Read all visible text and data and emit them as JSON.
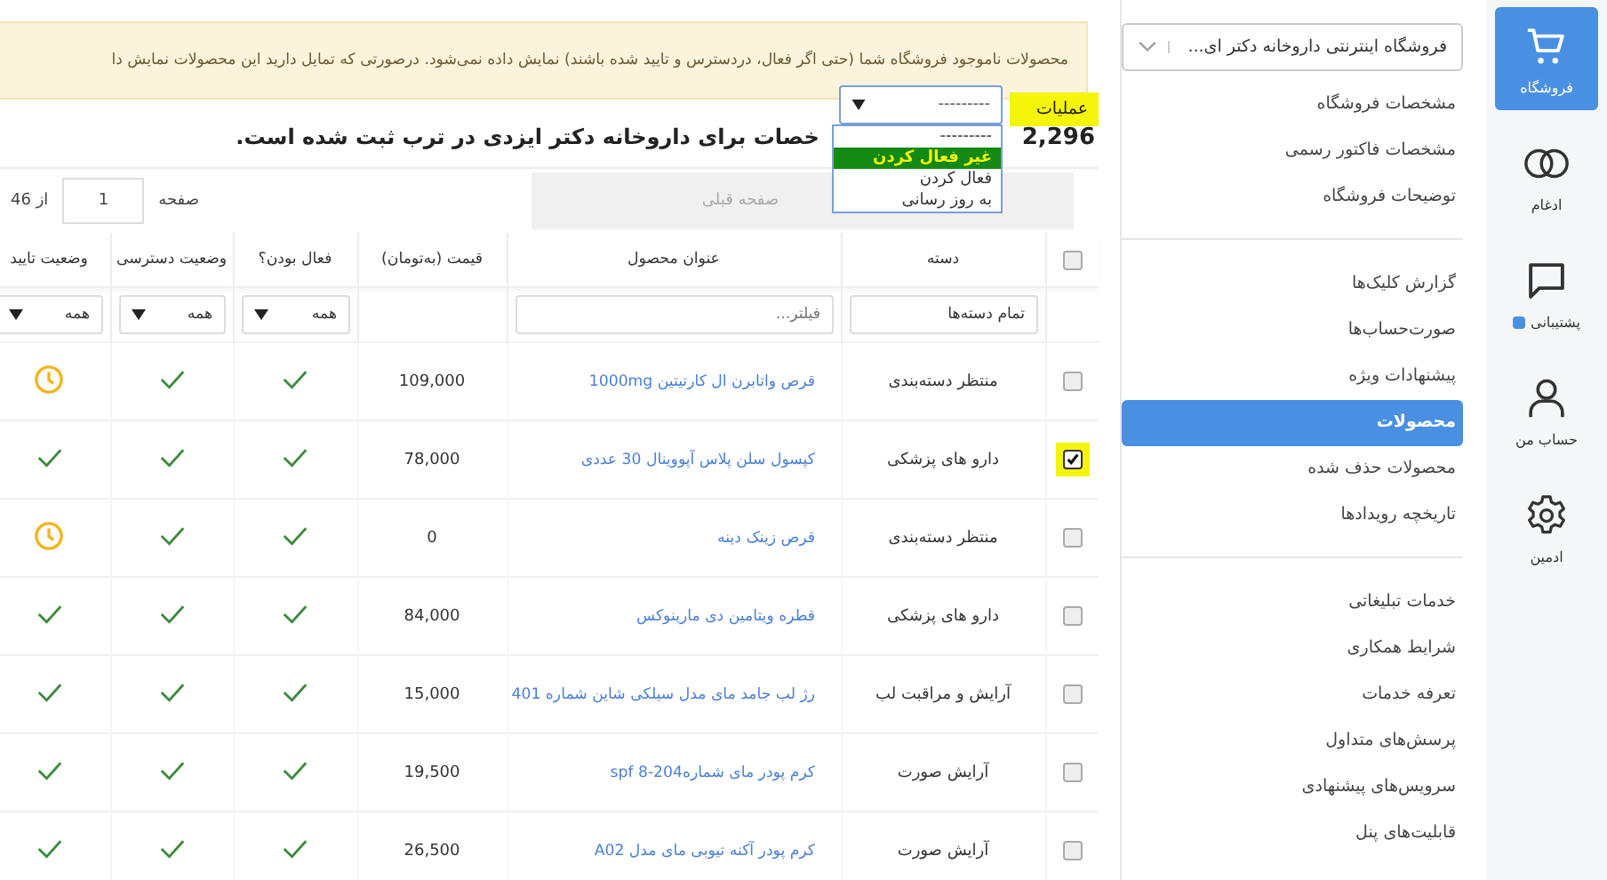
{
  "rail": [
    {
      "label": "فروشگاه",
      "kind": "cart",
      "selected": true
    },
    {
      "label": "ادغام",
      "kind": "rings",
      "selected": false
    },
    {
      "label": "پشتیبانی",
      "kind": "chat",
      "selected": false,
      "badge": true
    },
    {
      "label": "حساب من",
      "kind": "person",
      "selected": false
    },
    {
      "label": "ادمین",
      "kind": "gear",
      "selected": false
    }
  ],
  "sidebar": {
    "store_select": "فروشگاه اینترنتی داروخانه دکتر ای...",
    "groups": [
      [
        {
          "label": "مشخصات فروشگاه",
          "selected": false
        },
        {
          "label": "مشخصات فاکتور رسمی",
          "selected": false
        },
        {
          "label": "توضیحات فروشگاه",
          "selected": false
        }
      ],
      [
        {
          "label": "گزارش کلیک‌ها",
          "selected": false
        },
        {
          "label": "صورت‌حساب‌ها",
          "selected": false
        },
        {
          "label": "پیشنهادات ویژه",
          "selected": false
        },
        {
          "label": "محصولات",
          "selected": true
        },
        {
          "label": "محصولات حذف شده",
          "selected": false
        },
        {
          "label": "تاریخچه رویدادها",
          "selected": false
        }
      ],
      [
        {
          "label": "خدمات تبلیغاتی",
          "selected": false
        },
        {
          "label": "شرایط همکاری",
          "selected": false
        },
        {
          "label": "تعرفه خدمات",
          "selected": false
        },
        {
          "label": "پرسش‌های متداول",
          "selected": false
        },
        {
          "label": "سرویس‌های پیشنهادی",
          "selected": false
        },
        {
          "label": "قابلیت‌های پنل",
          "selected": false
        }
      ]
    ]
  },
  "banner": "محصولات ناموجود فروشگاه شما (حتی اگر فعال، دردسترس و تایید شده باشند) نمایش داده نمی‌شود. درصورتی که تمایل دارید این محصولات نمایش دا",
  "actions": {
    "label": "عملیات",
    "value": "---------",
    "options": [
      {
        "label": "---------",
        "highlighted": false
      },
      {
        "label": "غیر فعال کردن",
        "highlighted": true
      },
      {
        "label": "فعال کردن",
        "highlighted": false
      },
      {
        "label": "به روز رسانی",
        "highlighted": false
      }
    ]
  },
  "title": {
    "count": "2,296",
    "text": "خصات برای داروخانه دکتر ایزدی در ترب ثبت شده است."
  },
  "pagination": {
    "prev": "صفحه قبلی",
    "page_label": "صفحه",
    "page": "1",
    "of": "از 46"
  },
  "table": {
    "columns": [
      "دسته",
      "عنوان محصول",
      "قیمت (به‌تومان)",
      "فعال بودن؟",
      "وضعیت دسترسی",
      "وضعیت تایید"
    ],
    "filters": {
      "category": "تمام دسته‌ها",
      "title_placeholder": "فیلتر...",
      "active": "همه",
      "access": "همه",
      "approval": "همه"
    },
    "select_all_checked": false,
    "rows": [
      {
        "checked": false,
        "category": "منتظر دسته‌بندی",
        "title": "قرص واتابرن ال کارتیتین 1000mg",
        "price": "109,000",
        "active": true,
        "access": true,
        "approval": {
          "kind": "clock"
        }
      },
      {
        "checked": true,
        "category": "دارو های پزشکی",
        "title": "کپسول سلن پلاس آپووینال 30 عددی",
        "price": "78,000",
        "active": true,
        "access": true,
        "approval": {
          "kind": "check"
        }
      },
      {
        "checked": false,
        "category": "منتظر دسته‌بندی",
        "title": "قرص زینک دینه",
        "price": "0",
        "active": true,
        "access": true,
        "approval": {
          "kind": "clock"
        }
      },
      {
        "checked": false,
        "category": "دارو های پزشکی",
        "title": "قطره ویتامین دی مارینوکس",
        "price": "84,000",
        "active": true,
        "access": true,
        "approval": {
          "kind": "check"
        }
      },
      {
        "checked": false,
        "category": "آرایش و مراقبت لب",
        "title": "رژ لب جامد مای مدل سیلکی شاین شماره 401",
        "price": "15,000",
        "active": true,
        "access": true,
        "approval": {
          "kind": "check"
        }
      },
      {
        "checked": false,
        "category": "آرایش صورت",
        "title": "کرم پودر مای شماره204-8 spf",
        "price": "19,500",
        "active": true,
        "access": true,
        "approval": {
          "kind": "check"
        }
      },
      {
        "checked": false,
        "category": "آرایش صورت",
        "title": "کرم پودر آکنه تیوبی مای مدل A02",
        "price": "26,500",
        "active": true,
        "access": true,
        "approval": {
          "kind": "check"
        }
      }
    ]
  }
}
